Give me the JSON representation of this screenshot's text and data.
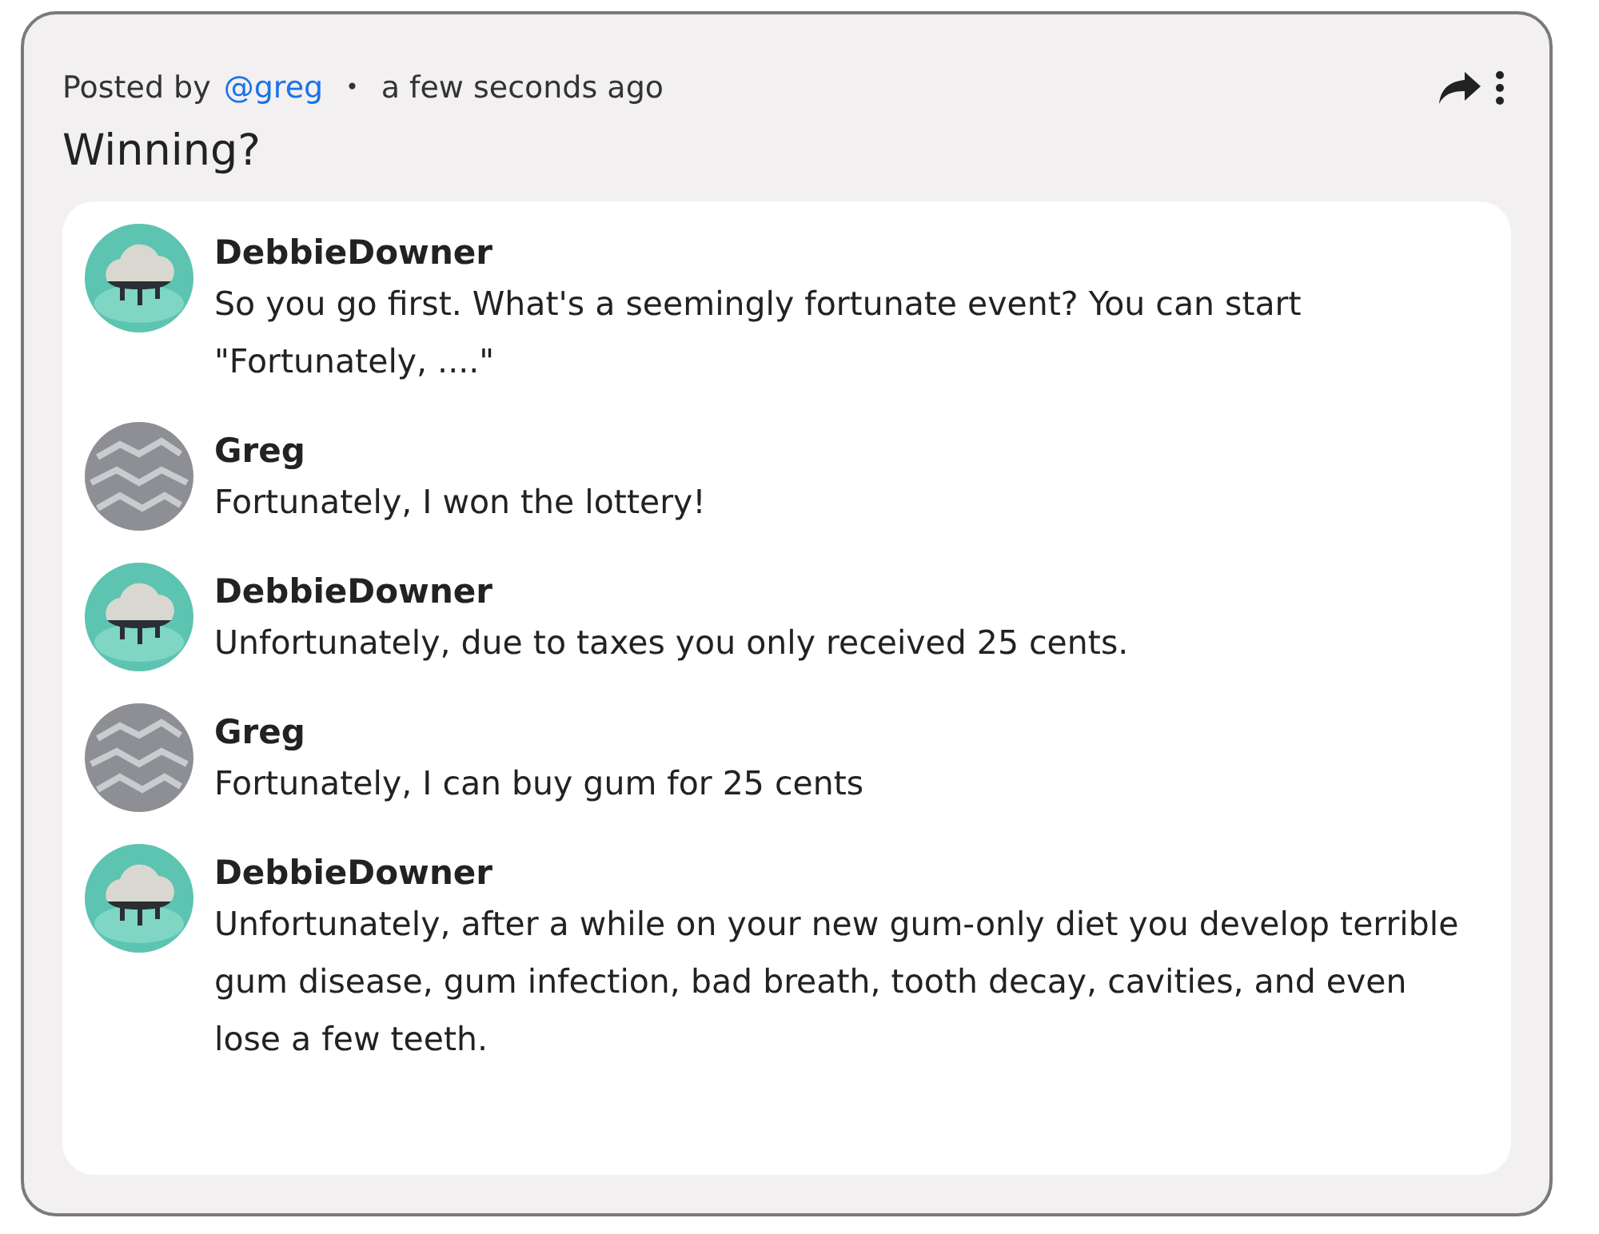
{
  "post": {
    "posted_by_label": "Posted by",
    "author_link": "@greg",
    "separator": "•",
    "time": "a few seconds ago",
    "title": "Winning?"
  },
  "messages": [
    {
      "author": "DebbieDowner",
      "kind": "cloud",
      "text": "So you go first. What's a seemingly fortunate event? You can start \"Fortunately, ....\""
    },
    {
      "author": "Greg",
      "kind": "texture",
      "text": "Fortunately, I won the lottery!"
    },
    {
      "author": "DebbieDowner",
      "kind": "cloud",
      "text": "Unfortunately, due to taxes you only received 25 cents."
    },
    {
      "author": "Greg",
      "kind": "texture",
      "text": "Fortunately, I can buy gum for 25 cents"
    },
    {
      "author": "DebbieDowner",
      "kind": "cloud",
      "text": "Unfortunately, after a while on your new gum-only diet you develop terrible gum disease, gum infection, bad breath, tooth decay, cavities, and even lose a few teeth."
    }
  ]
}
